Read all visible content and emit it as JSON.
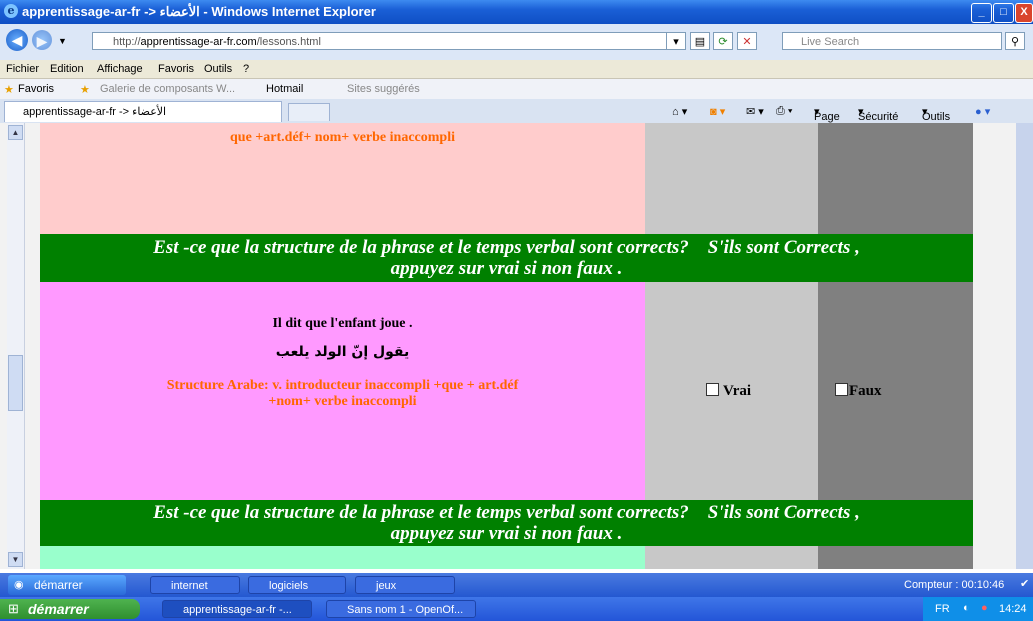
{
  "window": {
    "title": "apprentissage-ar-fr -> الأعضاء - Windows Internet Explorer",
    "controls": {
      "minimize": "_",
      "maximize": "□",
      "close": "X"
    }
  },
  "address": {
    "url_prefix": "http://",
    "url_host": "apprentissage-ar-fr.com",
    "url_path": "/lessons.html",
    "search_placeholder": "Live Search"
  },
  "menu": [
    "Fichier",
    "Edition",
    "Affichage",
    "Favoris",
    "Outils",
    "?"
  ],
  "favorites": {
    "label": "Favoris",
    "items": [
      "Galerie de composants W...",
      "Hotmail",
      "Sites suggérés"
    ]
  },
  "tab": {
    "label": "apprentissage-ar-fr -> الأعضاء"
  },
  "commandbar": {
    "page": "Page",
    "securite": "Sécurité",
    "outils": "Outils"
  },
  "lesson": {
    "row1_structure": "que +art.déf+ nom+ verbe inaccompli",
    "question_line1": "Est -ce que la structure de la phrase et le temps verbal sont corrects?    S'ils sont Corrects ,",
    "question_line2": "appuyez sur vrai si non faux .",
    "sentence_fr": "Il dit que l'enfant joue .",
    "sentence_ar": "يقول إنّ الولد يلعب",
    "structure_line1": "Structure Arabe: v. introducteur inaccompli +que + art.déf",
    "structure_line2": "+nom+ verbe inaccompli",
    "vrai": "Vrai",
    "faux": "Faux",
    "question2_line1": "Est -ce que la structure de la phrase et le temps verbal sont corrects?    S'ils sont Corrects ,",
    "question2_line2": "appuyez sur vrai si non faux ."
  },
  "taskbar_upper": {
    "start": "démarrer",
    "buttons": [
      "internet",
      "logiciels",
      "jeux"
    ],
    "counter": "Compteur : 00:10:46"
  },
  "taskbar_lower": {
    "start": "démarrer",
    "buttons": [
      "apprentissage-ar-fr -...",
      "Sans nom 1 - OpenOf..."
    ],
    "lang": "FR",
    "clock": "14:24"
  }
}
